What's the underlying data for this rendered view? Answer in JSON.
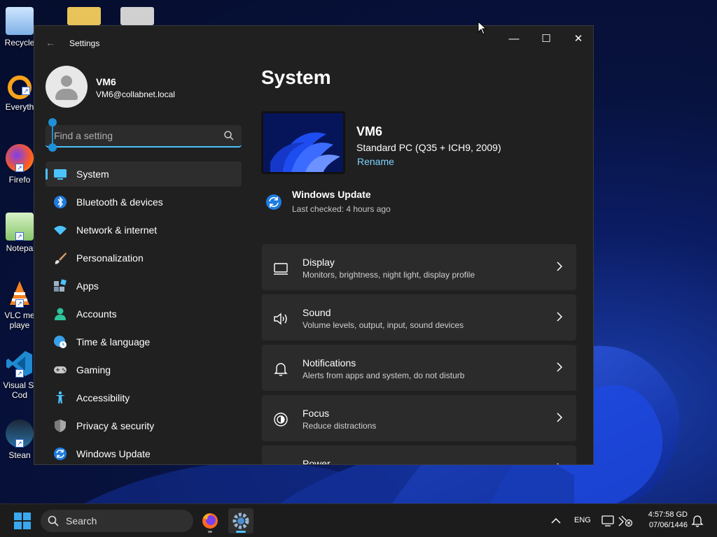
{
  "desktop": {
    "icons": [
      {
        "name": "recycle-bin",
        "label": "Recycle"
      },
      {
        "name": "everything",
        "label": "Everyth"
      },
      {
        "name": "firefox",
        "label": "Firefo"
      },
      {
        "name": "notepad",
        "label": "Notepa"
      },
      {
        "name": "vlc",
        "label": "VLC me\nplaye"
      },
      {
        "name": "vscode",
        "label": "Visual St\nCod"
      },
      {
        "name": "steam",
        "label": "Stean"
      }
    ]
  },
  "window": {
    "title": "Settings",
    "controls": {
      "minimize": "—",
      "maximize": "☐",
      "close": "✕"
    }
  },
  "sidebar": {
    "profile": {
      "name": "VM6",
      "email": "VM6@collabnet.local"
    },
    "search": {
      "placeholder": "Find a setting"
    },
    "items": [
      {
        "label": "System",
        "icon": "system-icon",
        "selected": true
      },
      {
        "label": "Bluetooth & devices",
        "icon": "bluetooth-icon"
      },
      {
        "label": "Network & internet",
        "icon": "wifi-icon"
      },
      {
        "label": "Personalization",
        "icon": "brush-icon"
      },
      {
        "label": "Apps",
        "icon": "apps-icon"
      },
      {
        "label": "Accounts",
        "icon": "accounts-icon"
      },
      {
        "label": "Time & language",
        "icon": "time-language-icon"
      },
      {
        "label": "Gaming",
        "icon": "gaming-icon"
      },
      {
        "label": "Accessibility",
        "icon": "accessibility-icon"
      },
      {
        "label": "Privacy & security",
        "icon": "shield-icon"
      },
      {
        "label": "Windows Update",
        "icon": "windows-update-icon"
      }
    ]
  },
  "main": {
    "title": "System",
    "device": {
      "name": "VM6",
      "model": "Standard PC (Q35 + ICH9, 2009)",
      "rename": "Rename"
    },
    "windows_update": {
      "title": "Windows Update",
      "subtitle": "Last checked: 4 hours ago"
    },
    "cards": [
      {
        "title": "Display",
        "subtitle": "Monitors, brightness, night light, display profile",
        "icon": "display-icon"
      },
      {
        "title": "Sound",
        "subtitle": "Volume levels, output, input, sound devices",
        "icon": "sound-icon"
      },
      {
        "title": "Notifications",
        "subtitle": "Alerts from apps and system, do not disturb",
        "icon": "bell-icon"
      },
      {
        "title": "Focus",
        "subtitle": "Reduce distractions",
        "icon": "focus-icon"
      },
      {
        "title": "Power",
        "subtitle": "",
        "icon": "power-icon"
      }
    ]
  },
  "taskbar": {
    "search_label": "Search",
    "language": "ENG",
    "time": "4:57:58 GD",
    "date": "07/06/1446"
  },
  "colors": {
    "accent": "#4cc2ff",
    "window_bg": "#202020",
    "card_bg": "#2b2b2b"
  }
}
